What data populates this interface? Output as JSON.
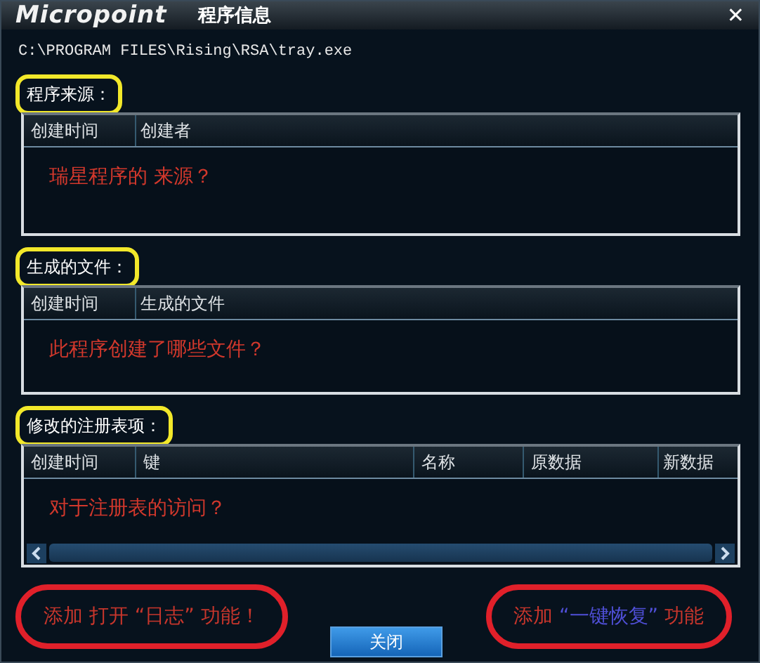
{
  "window": {
    "logo": "Micropoint",
    "title": "程序信息",
    "close": "✕"
  },
  "path": "C:\\PROGRAM FILES\\Rising\\RSA\\tray.exe",
  "sections": [
    {
      "label": "程序来源：",
      "highlighted": true,
      "columns": [
        "创建时间",
        "创建者"
      ],
      "note": "瑞星程序的 来源？",
      "scrollbar": false
    },
    {
      "label": "生成的文件：",
      "highlighted": true,
      "columns": [
        "创建时间",
        "生成的文件"
      ],
      "note": "此程序创建了哪些文件？",
      "scrollbar": false
    },
    {
      "label": "修改的注册表项：",
      "highlighted": true,
      "columns": [
        "创建时间",
        "键",
        "名称",
        "原数据",
        "新数据"
      ],
      "note": "对于注册表的访问？",
      "scrollbar": true
    }
  ],
  "annotations": [
    {
      "circled": true,
      "parts": [
        {
          "text": "添加 打开  “日志”  功能！",
          "color": "#c8362c"
        }
      ]
    },
    {
      "circled": true,
      "parts": [
        {
          "text": "添加 ",
          "color": "#c8362c"
        },
        {
          "text": "“一键恢复”",
          "color": "#4f4fd6"
        },
        {
          "text": " 功能",
          "color": "#c8362c"
        }
      ]
    }
  ],
  "buttons": [
    "关闭"
  ]
}
